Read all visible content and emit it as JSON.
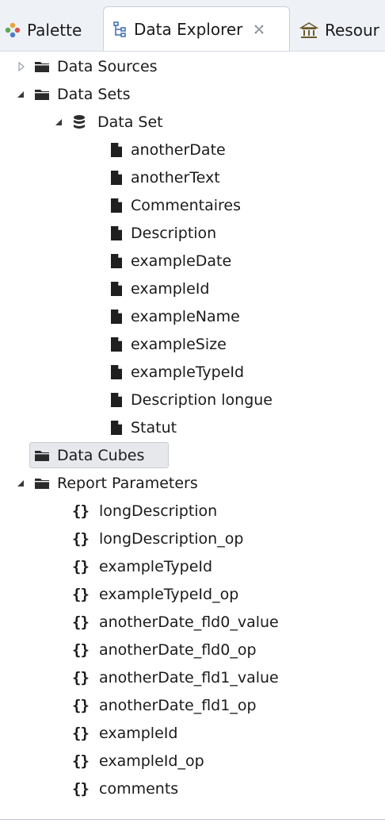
{
  "tabs": {
    "palette": {
      "label": "Palette"
    },
    "data_explorer": {
      "label": "Data Explorer",
      "close_glyph": "✕"
    },
    "resource": {
      "label": "Resour"
    }
  },
  "tree": {
    "data_sources": {
      "label": "Data Sources",
      "expanded": false
    },
    "data_sets": {
      "label": "Data Sets",
      "expanded": true,
      "data_set": {
        "label": "Data Set",
        "expanded": true,
        "fields": [
          "anotherDate",
          "anotherText",
          "Commentaires",
          "Description",
          "exampleDate",
          "exampleId",
          "exampleName",
          "exampleSize",
          "exampleTypeId",
          "Description longue",
          "Statut"
        ]
      }
    },
    "data_cubes": {
      "label": "Data Cubes",
      "selected": true
    },
    "report_parameters": {
      "label": "Report Parameters",
      "expanded": true,
      "braces_glyph": "{}",
      "items": [
        "longDescription",
        "longDescription_op",
        "exampleTypeId",
        "exampleTypeId_op",
        "anotherDate_fld0_value",
        "anotherDate_fld0_op",
        "anotherDate_fld1_value",
        "anotherDate_fld1_op",
        "exampleId",
        "exampleId_op",
        "comments"
      ]
    }
  },
  "colors": {
    "folder": "#2b2b2b",
    "file": "#1f1f1f",
    "twisty_collapsed": "#9aa0a8",
    "twisty_expanded": "#3a3a3a",
    "tab_bar": "#eef1f6",
    "selection": "#e6e8ec"
  },
  "icons": {
    "palette_tab": "palette-icon",
    "explorer_tab": "data-explorer-icon",
    "resource_tab": "resource-icon",
    "folder": "folder-icon",
    "dataset": "database-icon",
    "field": "file-icon",
    "parameter": "braces-icon"
  }
}
